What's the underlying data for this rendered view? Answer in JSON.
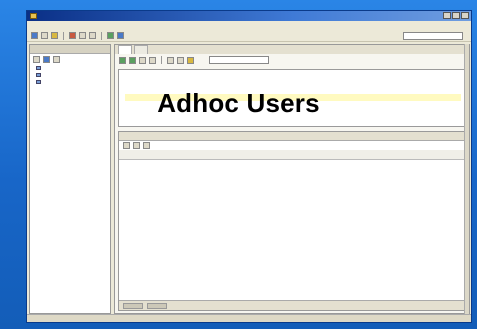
{
  "overlay": {
    "title": "Adhoc Users"
  },
  "colors": {
    "slide_bg": "#1a6fd0",
    "titlebar": "#0a2f86",
    "window": "#ece9d8"
  },
  "window": {
    "title": "",
    "icons": [
      "app-icon",
      "minimize-icon",
      "maximize-icon",
      "close-icon"
    ]
  },
  "menu": {
    "items": [
      "",
      "",
      "",
      "",
      "",
      "",
      "",
      "",
      ""
    ]
  },
  "left_pane": {
    "header": "",
    "tree": [
      "",
      "",
      ""
    ]
  },
  "editor": {
    "tabs": [
      "",
      ""
    ],
    "connection": ""
  },
  "results": {
    "tabs": [
      "",
      "",
      "",
      "",
      "",
      ""
    ],
    "columns": [
      "",
      "",
      "",
      ""
    ],
    "rows": [
      [
        "",
        "",
        "",
        ""
      ],
      [
        "",
        "",
        "",
        ""
      ],
      [
        "",
        "",
        "",
        ""
      ],
      [
        "",
        "",
        "",
        ""
      ],
      [
        "",
        "",
        "",
        ""
      ],
      [
        "",
        "",
        "",
        ""
      ],
      [
        "",
        "",
        "",
        ""
      ],
      [
        "",
        "",
        "",
        ""
      ],
      [
        "",
        "",
        "",
        ""
      ],
      [
        "",
        "",
        "",
        ""
      ]
    ],
    "status": ""
  },
  "statusbar": {
    "left": "",
    "right": ""
  }
}
